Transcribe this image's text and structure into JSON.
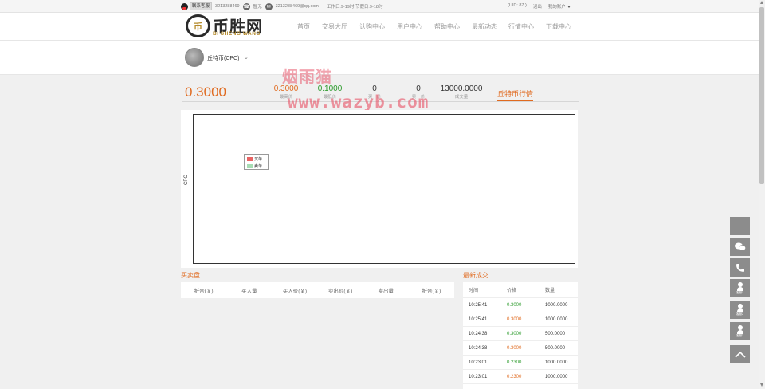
{
  "topbar": {
    "contact_label": "联系客服",
    "qq_number": "3213288469",
    "phone_label": "暂无",
    "email": "3213288469@qq.com",
    "hours": "工作日:9-19时 节假日:9-18时",
    "uid": "(UID: 87 )",
    "logout": "退出",
    "my_account": "我的账户"
  },
  "logo": {
    "cn": "币胜网",
    "en": "BI SHENG WANG",
    "mark": "币"
  },
  "nav": [
    "首页",
    "交易大厅",
    "认购中心",
    "用户中心",
    "帮助中心",
    "最新动态",
    "行情中心",
    "下载中心"
  ],
  "coin": {
    "name": "丘特币(CPC)"
  },
  "price": {
    "current": "0.3000",
    "high": "0.3000",
    "high_label": "最高价",
    "low": "0.1000",
    "low_label": "最低价",
    "buy1": "0",
    "buy1_label": "买一价",
    "sell1": "0",
    "sell1_label": "卖一价",
    "volume": "13000.0000",
    "volume_label": "成交量",
    "tab": "丘特币行情"
  },
  "watermark": {
    "cn": "烟雨猫",
    "en": "www.wazyb.com"
  },
  "chart": {
    "ylabel": "CPC",
    "legend_buy": "买单",
    "legend_sell": "卖单",
    "buy_color": "#e86464",
    "sell_color": "#a7dcb3"
  },
  "chart_data": {
    "type": "area",
    "title": "",
    "xlabel": "",
    "ylabel": "CPC",
    "series": [
      {
        "name": "买单",
        "values": []
      },
      {
        "name": "卖单",
        "values": []
      }
    ],
    "legend": "top-left",
    "grid": false
  },
  "orderbook": {
    "title": "买卖盘",
    "columns": [
      "折合(￥)",
      "买入量",
      "买入价(￥)",
      "卖出价(￥)",
      "卖出量",
      "折合(￥)"
    ]
  },
  "trades": {
    "title": "最新成交",
    "columns": [
      "时间",
      "价格",
      "数量"
    ],
    "rows": [
      {
        "time": "10:25:41",
        "price": "0.3000",
        "amount": "1000.0000",
        "color": "#2a9a2a"
      },
      {
        "time": "10:25:41",
        "price": "0.3000",
        "amount": "1000.0000",
        "color": "#e06a1f"
      },
      {
        "time": "10:24:38",
        "price": "0.3000",
        "amount": "500.0000",
        "color": "#2a9a2a"
      },
      {
        "time": "10:24:38",
        "price": "0.3000",
        "amount": "500.0000",
        "color": "#e06a1f"
      },
      {
        "time": "10:23:01",
        "price": "0.2300",
        "amount": "1000.0000",
        "color": "#2a9a2a"
      },
      {
        "time": "10:23:01",
        "price": "0.2300",
        "amount": "1000.0000",
        "color": "#e06a1f"
      }
    ]
  },
  "side": {
    "service1": "客服1",
    "service2": "客服2",
    "service3": "客服3"
  },
  "colors": {
    "accent": "#e06a1f",
    "green": "#2a9a2a"
  }
}
